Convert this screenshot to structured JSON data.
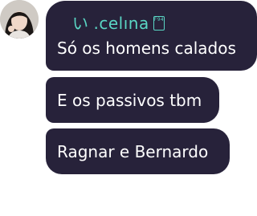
{
  "chat": {
    "sender": {
      "prefix": "い",
      "name": ".celına",
      "badge": "F94"
    },
    "messages": [
      {
        "text": "Só os homens calados"
      },
      {
        "text": "E os passivos tbm"
      },
      {
        "text": "Ragnar e Bernardo"
      }
    ]
  },
  "colors": {
    "bubble": "#27223a",
    "text": "#ffffff",
    "sender": "#5ad6c4",
    "background": "#ffffff"
  }
}
